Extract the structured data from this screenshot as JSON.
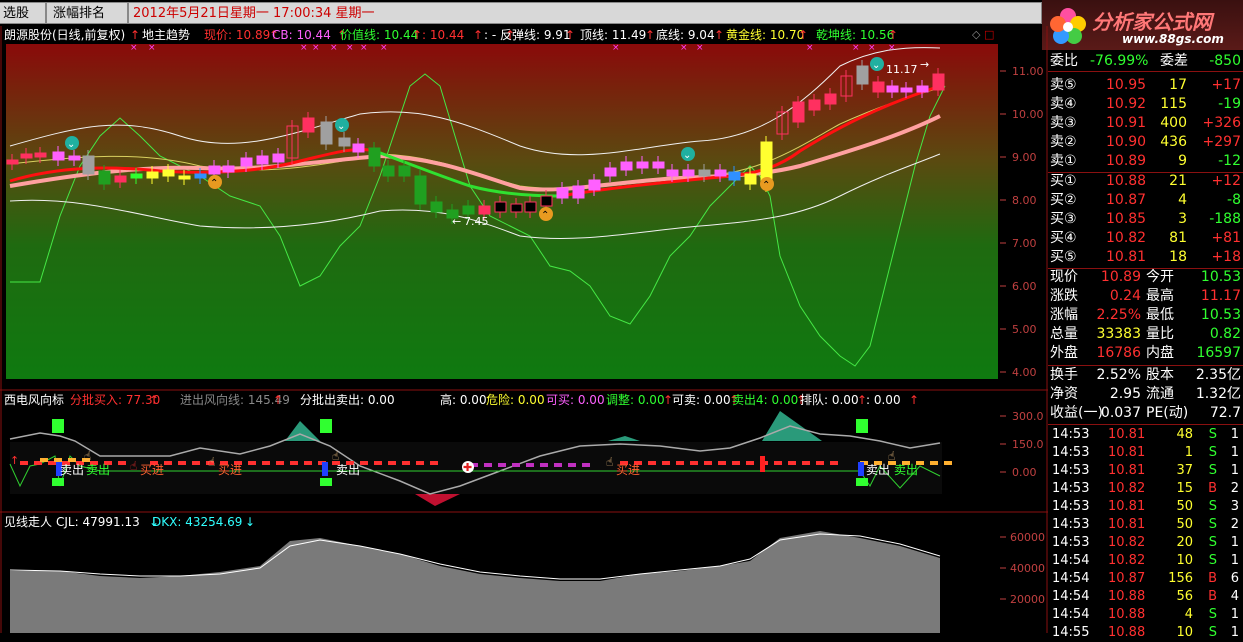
{
  "topbar": {
    "tab_stock": "选股",
    "tab_rank": "涨幅排名",
    "datetime": "2012年5月21日星期一  17:00:34 星期一"
  },
  "logo": {
    "name": "分析家公式网",
    "url": "www.88gs.com"
  },
  "main_header": {
    "stock": "朗源股份(日线,前复权)",
    "indicator": "地主趋势",
    "items": [
      {
        "text": "现价: 10.89",
        "color": "#ff3030"
      },
      {
        "text": "CB: 10.44",
        "color": "#ff60ff"
      },
      {
        "text": "价值线: 10.44",
        "color": "#30ff30"
      },
      {
        "text": ": 10.44",
        "color": "#ff3030"
      },
      {
        "text": ": -",
        "color": "#ffffff"
      },
      {
        "text": "反弹线: 9.91",
        "color": "#ffffff"
      },
      {
        "text": "顶线: 11.49",
        "color": "#ffffff"
      },
      {
        "text": "底线: 9.04",
        "color": "#ffffff"
      },
      {
        "text": "黄金线: 10.70",
        "color": "#ffff30"
      },
      {
        "text": "乾坤线: 10.56",
        "color": "#30ff30"
      }
    ],
    "arrow": "↑"
  },
  "main_axis": [
    "11.00",
    "10.00",
    "9.00",
    "8.00",
    "7.00",
    "6.00",
    "5.00",
    "4.00"
  ],
  "annotations": {
    "high": "11.17",
    "low": "7.45"
  },
  "panel2_header": {
    "title": "西电风向标",
    "items": [
      {
        "text": "分批买入: 77.30",
        "color": "#ff3030"
      },
      {
        "text": "进出风向线: 145.49",
        "color": "#888888"
      },
      {
        "text": "分批出卖出: 0.00",
        "color": "#ffffff"
      }
    ],
    "items2": [
      {
        "text": "高: 0.00",
        "color": "#ffffff"
      },
      {
        "text": "危险: 0.00",
        "color": "#ffff30"
      },
      {
        "text": "可买: 0.00",
        "color": "#ff60ff"
      },
      {
        "text": "调整: 0.00",
        "color": "#30ff30"
      },
      {
        "text": "可卖: 0.00",
        "color": "#ffffff"
      },
      {
        "text": "卖出4: 0.00",
        "color": "#30ff30"
      },
      {
        "text": "排队: 0.00",
        "color": "#ffffff"
      },
      {
        "text": ": 0.00",
        "color": "#ffffff"
      }
    ],
    "axis": [
      "300.0",
      "150.0",
      "0.00"
    ],
    "labels": {
      "buy": "买进",
      "sell": "卖出"
    }
  },
  "panel3_header": {
    "title": "见线走人",
    "items": [
      {
        "text": "CJL: 47991.13",
        "color": "#ffffff"
      },
      {
        "text": "DKX: 43254.69",
        "color": "#30ffff"
      }
    ],
    "arrow": "↓",
    "axis": [
      "60000",
      "40000",
      "20000"
    ]
  },
  "quote": {
    "ratio": {
      "label": "委比",
      "value": "-76.99%",
      "label2": "委差",
      "value2": "-850"
    },
    "sells": [
      {
        "label": "卖⑤",
        "price": "10.95",
        "vol": "17",
        "chg": "+17"
      },
      {
        "label": "卖④",
        "price": "10.92",
        "vol": "115",
        "chg": "-19"
      },
      {
        "label": "卖③",
        "price": "10.91",
        "vol": "400",
        "chg": "+326"
      },
      {
        "label": "卖②",
        "price": "10.90",
        "vol": "436",
        "chg": "+297"
      },
      {
        "label": "卖①",
        "price": "10.89",
        "vol": "9",
        "chg": "-12"
      }
    ],
    "buys": [
      {
        "label": "买①",
        "price": "10.88",
        "vol": "21",
        "chg": "+12"
      },
      {
        "label": "买②",
        "price": "10.87",
        "vol": "4",
        "chg": "-8"
      },
      {
        "label": "买③",
        "price": "10.85",
        "vol": "3",
        "chg": "-188"
      },
      {
        "label": "买④",
        "price": "10.82",
        "vol": "81",
        "chg": "+81"
      },
      {
        "label": "买⑤",
        "price": "10.81",
        "vol": "18",
        "chg": "+18"
      }
    ],
    "stats": [
      {
        "l1": "现价",
        "v1": "10.89",
        "c1": "#ff3030",
        "l2": "今开",
        "v2": "10.53",
        "c2": "#30ff30"
      },
      {
        "l1": "涨跌",
        "v1": "0.24",
        "c1": "#ff3030",
        "l2": "最高",
        "v2": "11.17",
        "c2": "#ff3030"
      },
      {
        "l1": "涨幅",
        "v1": "2.25%",
        "c1": "#ff3030",
        "l2": "最低",
        "v2": "10.53",
        "c2": "#30ff30"
      },
      {
        "l1": "总量",
        "v1": "33383",
        "c1": "#ffff30",
        "l2": "量比",
        "v2": "0.82",
        "c2": "#30ff30"
      },
      {
        "l1": "外盘",
        "v1": "16786",
        "c1": "#ff3030",
        "l2": "内盘",
        "v2": "16597",
        "c2": "#30ff30"
      }
    ],
    "stats2": [
      {
        "l1": "换手",
        "v1": "2.52%",
        "l2": "股本",
        "v2": "2.35亿"
      },
      {
        "l1": "净资",
        "v1": "2.95",
        "l2": "流通",
        "v2": "1.32亿"
      },
      {
        "l1": "收益(一)",
        "v1": "0.037",
        "l2": "PE(动)",
        "v2": "72.7"
      }
    ],
    "ticks": [
      {
        "time": "14:53",
        "price": "10.81",
        "vol": "48",
        "bs": "S",
        "n": "1"
      },
      {
        "time": "14:53",
        "price": "10.81",
        "vol": "1",
        "bs": "S",
        "n": "1"
      },
      {
        "time": "14:53",
        "price": "10.81",
        "vol": "37",
        "bs": "S",
        "n": "1"
      },
      {
        "time": "14:53",
        "price": "10.82",
        "vol": "15",
        "bs": "B",
        "n": "2"
      },
      {
        "time": "14:53",
        "price": "10.81",
        "vol": "50",
        "bs": "S",
        "n": "3"
      },
      {
        "time": "14:53",
        "price": "10.81",
        "vol": "50",
        "bs": "S",
        "n": "2"
      },
      {
        "time": "14:53",
        "price": "10.82",
        "vol": "20",
        "bs": "S",
        "n": "1"
      },
      {
        "time": "14:54",
        "price": "10.82",
        "vol": "10",
        "bs": "S",
        "n": "1"
      },
      {
        "time": "14:54",
        "price": "10.87",
        "vol": "156",
        "bs": "B",
        "n": "6"
      },
      {
        "time": "14:54",
        "price": "10.88",
        "vol": "56",
        "bs": "B",
        "n": "4"
      },
      {
        "time": "14:54",
        "price": "10.88",
        "vol": "4",
        "bs": "S",
        "n": "1"
      },
      {
        "time": "14:55",
        "price": "10.88",
        "vol": "10",
        "bs": "S",
        "n": "1"
      }
    ]
  }
}
